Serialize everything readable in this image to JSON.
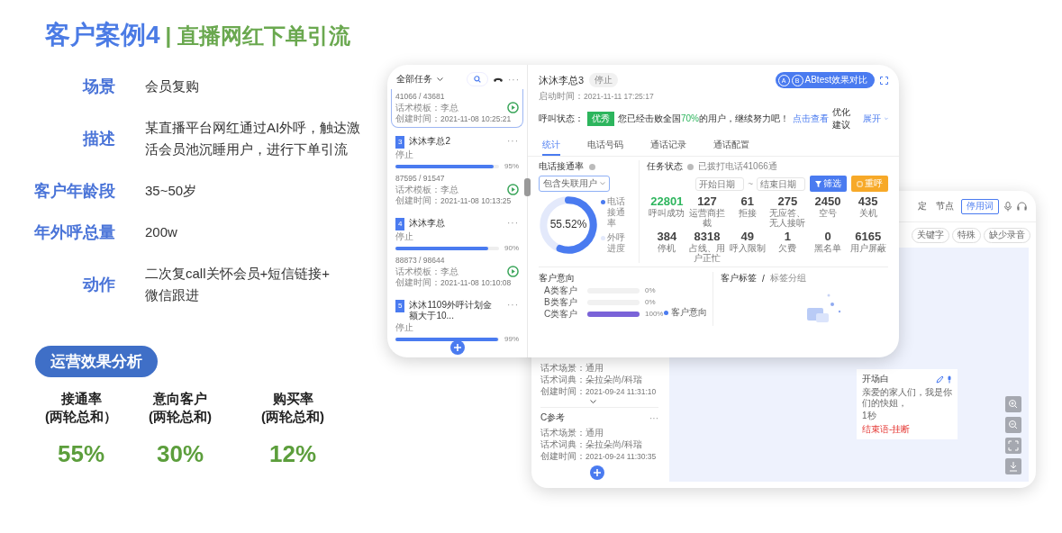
{
  "title": {
    "case": "客户案例4",
    "subtitle": "| 直播网红下单引流"
  },
  "details": [
    {
      "label": "场景",
      "lines": [
        "会员复购"
      ]
    },
    {
      "label": "描述",
      "lines": [
        "某直播平台网红通过AI外呼，触达激",
        "活会员池沉睡用户，进行下单引流"
      ]
    },
    {
      "label": "客户年龄段",
      "lines": [
        "35~50岁"
      ]
    },
    {
      "label": "年外呼总量",
      "lines": [
        "200w"
      ]
    },
    {
      "label": "动作",
      "lines": [
        "二次复call关怀会员+短信链接+",
        "微信跟进"
      ]
    }
  ],
  "effect_title": "运营效果分析",
  "metrics": [
    {
      "label": "接通率",
      "sublabel": "(两轮总和）",
      "value": "55%"
    },
    {
      "label": "意向客户",
      "sublabel": "(两轮总和)",
      "value": "30%"
    },
    {
      "label": "购买率",
      "sublabel": "(两轮总和)",
      "value": "12%"
    }
  ],
  "dashboard_app": {
    "sidebar": {
      "filter": "全部任务",
      "more": "···",
      "tasks": [
        {
          "selected": true,
          "counts": "41066 / 43681",
          "template_label": "话术模板：",
          "template": "李总",
          "created_label": "创建时间：",
          "created": "2021-11-08 10:25:21"
        },
        {
          "selected": false,
          "number": "3",
          "name": "沐沐李总2",
          "more": "···",
          "status": "停止",
          "level": 0.95,
          "percent": "95%",
          "counts": "87595 / 91547",
          "template_label": "话术模板：",
          "template": "李总",
          "created_label": "创建时间：",
          "created": "2021-11-08 10:13:25"
        },
        {
          "selected": false,
          "number": "4",
          "name": "沐沐李总",
          "more": "···",
          "status": "停止",
          "level": 0.9,
          "percent": "90%",
          "counts": "88873 / 98644",
          "template_label": "话术模板：",
          "template": "李总",
          "created_label": "创建时间：",
          "created": "2021-11-08 10:10:08"
        },
        {
          "selected": false,
          "number": "5",
          "name": "沐沐1109外呼计划金额大于10...",
          "more": "···",
          "status": "停止",
          "level": 0.99,
          "percent": "99%"
        }
      ]
    },
    "header": {
      "name": "沐沐李总3",
      "status": "停止",
      "start_label": "启动时间：",
      "start": "2021-11-11 17:25:17",
      "ab_letters": [
        "A",
        "B"
      ],
      "ab_button": "ABtest效果对比",
      "call_status_label": "呼叫状态：",
      "grade": "优秀",
      "beat_before": "您已经击败全国",
      "beat_highlight": "70%",
      "beat_after": "的用户，继续努力吧！",
      "link": "点击查看",
      "advice": "优化建议",
      "expand": "展开"
    },
    "tabs": [
      {
        "label": "统计",
        "selected": true
      },
      {
        "label": "电话号码",
        "selected": false
      },
      {
        "label": "通话记录",
        "selected": false
      },
      {
        "label": "通话配置",
        "selected": false
      }
    ],
    "connect_rate": {
      "title": "电话接通率",
      "select": "包含失联用户",
      "level": 0.5552,
      "value": "55.52%",
      "legend": [
        {
          "label": "电话接通率",
          "color": "#4a7bf0"
        },
        {
          "label": "外呼进度",
          "color": "#e3e9fb"
        }
      ]
    },
    "task_status": {
      "title": "任务状态",
      "note": "已拨打电话41066通",
      "start_placeholder": "开始日期",
      "separator": "~",
      "end_placeholder": "结束日期",
      "filter_button": "筛选",
      "recall_button": "重呼",
      "stats": [
        {
          "value": "22801",
          "label": "呼叫成功",
          "highlight": true
        },
        {
          "value": "127",
          "label": "运营商拦截",
          "highlight": false
        },
        {
          "value": "61",
          "label": "拒接",
          "highlight": false
        },
        {
          "value": "275",
          "label": "无应答、无人接听",
          "highlight": false
        },
        {
          "value": "2450",
          "label": "空号",
          "highlight": false
        },
        {
          "value": "435",
          "label": "关机",
          "highlight": false
        },
        {
          "value": "384",
          "label": "停机",
          "highlight": false
        },
        {
          "value": "8318",
          "label": "占线、用户正忙",
          "highlight": false
        },
        {
          "value": "49",
          "label": "呼入限制",
          "highlight": false
        },
        {
          "value": "1",
          "label": "欠费",
          "highlight": false
        },
        {
          "value": "0",
          "label": "黑名单",
          "highlight": false
        },
        {
          "value": "6165",
          "label": "用户屏蔽",
          "highlight": false
        }
      ]
    },
    "intent": {
      "title": "客户意向",
      "rows": [
        {
          "label": "A类客户",
          "level": 0,
          "percent": "0%"
        },
        {
          "label": "B类客户",
          "level": 0,
          "percent": "0%"
        },
        {
          "label": "C类客户",
          "level": 1,
          "percent": "100%"
        }
      ],
      "legend": "客户意向"
    },
    "tags": {
      "title": "客户标签",
      "separator": "/",
      "subtitle": "标签分组"
    }
  },
  "editor_app": {
    "tabs": [
      "定",
      "节点"
    ],
    "stopword_button": "停用词",
    "chips": [
      "关键字",
      "特殊",
      "缺少录音"
    ],
    "scripts": [
      {
        "scene_label": "话术场景：",
        "scene": "通用",
        "dict_label": "话术词典：",
        "dict": "朵拉朵尚/科瑞",
        "created_label": "创建时间：",
        "created": "2021-09-24 11:31:10"
      },
      {
        "name": "C参考",
        "more": "···",
        "scene_label": "话术场景：",
        "scene": "通用",
        "dict_label": "话术词典：",
        "dict": "朵拉朵尚/科瑞",
        "created_label": "创建时间：",
        "created": "2021-09-24 11:30:35"
      }
    ],
    "node": {
      "title": "开场白",
      "text": "亲爱的家人们，我是你们的快姐，",
      "duration": "1秒",
      "end": "结束语-挂断"
    }
  }
}
